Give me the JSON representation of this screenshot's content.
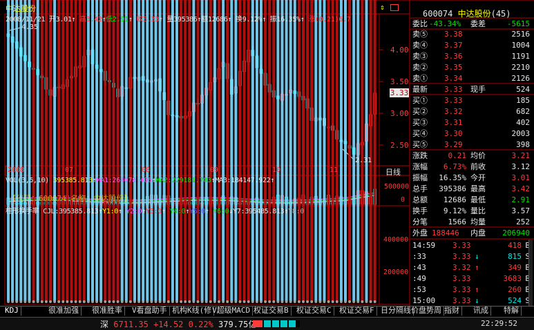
{
  "header": {
    "stock_name": "中达股份",
    "date": "2008/11/21",
    "open_label": "开",
    "open": "3.01",
    "high_label": "高",
    "high": "3.42",
    "low_label": "低",
    "low": "2.91",
    "close_label": "收",
    "close": "3.33",
    "volume_label": "量",
    "volume": "395386",
    "amount_label": "额",
    "amount": "12686",
    "turnover_label": "换",
    "turnover": "9.12%",
    "amplitude_label": "振",
    "amplitude": "16.35%",
    "change_label": "涨",
    "change": "(0.21)6.7"
  },
  "price_chart": {
    "y_ticks": [
      "4.00",
      "3.50",
      "3.00",
      "2.50"
    ],
    "high_marker": "4.35",
    "low_marker": "2.31",
    "current_price_tag": "3.33",
    "x_labels": [
      "2008",
      "07",
      "08",
      "09",
      "10",
      "11"
    ],
    "period_label": "日线"
  },
  "volume_panel": {
    "title": "VOL(3,5,10)",
    "vol": "395385.813",
    "ma1_label": "MA1:",
    "ma1": "264078.406",
    "ma2_label": "MA2:",
    "ma2": "229181.703",
    "ma3_label": "MA3:",
    "ma3": "184147.922",
    "code_text": "【代码：600074 名称：中达股份】",
    "y_ticks": [
      "500000",
      "0"
    ]
  },
  "indicator_panel": {
    "title": "柱形换手率",
    "cjl_label": "CJL:",
    "cjl": "395385.813",
    "y1": "Y1:0",
    "y2": "Y2:0",
    "y3": "Y3:0",
    "y4": "Y4:0",
    "y5": "Y5:0",
    "y6": "Y6:0",
    "y7_label": "Y7:",
    "y7": "395485.813",
    "y8": "Y8:0",
    "y_ticks": [
      "400000",
      "200000"
    ]
  },
  "tabs": [
    "KDJ",
    "很准加强",
    "很准胜率",
    "V看盘助手",
    "机构K线(修",
    "V超级MACD",
    "权证交易B",
    "权证交易C",
    "权证交易F",
    "日分隔线",
    "价盘势周",
    "指财",
    "讯成",
    "特解"
  ],
  "status_bar": {
    "index_name": "深",
    "index_value": "6711.35",
    "index_change": "+14.52",
    "index_pct": "0.22%",
    "index_amount": "379.75亿",
    "time": "22:29:52"
  },
  "quote": {
    "code": "600074",
    "name": "中达股份",
    "rank": "(45)",
    "weibi_label": "委比",
    "weibi": "-43.34%",
    "weicha_label": "委差",
    "weicha": "-5615",
    "asks": [
      {
        "label": "卖⑤",
        "price": "3.38",
        "vol": "2516"
      },
      {
        "label": "卖④",
        "price": "3.37",
        "vol": "1004"
      },
      {
        "label": "卖③",
        "price": "3.36",
        "vol": "1191"
      },
      {
        "label": "卖②",
        "price": "3.35",
        "vol": "2210"
      },
      {
        "label": "卖①",
        "price": "3.34",
        "vol": "2126"
      }
    ],
    "last_label": "最新",
    "last": "3.33",
    "cur_hand_label": "现手",
    "cur_hand": "524",
    "bids": [
      {
        "label": "买①",
        "price": "3.33",
        "vol": "185"
      },
      {
        "label": "买②",
        "price": "3.32",
        "vol": "682"
      },
      {
        "label": "买③",
        "price": "3.31",
        "vol": "402"
      },
      {
        "label": "买④",
        "price": "3.30",
        "vol": "2003"
      },
      {
        "label": "买⑤",
        "price": "3.29",
        "vol": "398"
      }
    ],
    "stats": [
      {
        "l1": "涨跌",
        "v1": "0.21",
        "l2": "均价",
        "v2": "3.21"
      },
      {
        "l1": "涨幅",
        "v1": "6.73%",
        "l2": "前收",
        "v2": "3.12"
      },
      {
        "l1": "振幅",
        "v1": "16.35%",
        "l2": "今开",
        "v2": "3.01"
      },
      {
        "l1": "总手",
        "v1": "395386",
        "l2": "最高",
        "v2": "3.42"
      },
      {
        "l1": "总额",
        "v1": "12686",
        "l2": "最低",
        "v2": "2.91"
      },
      {
        "l1": "换手",
        "v1": "9.12%",
        "l2": "量比",
        "v2": "3.57"
      },
      {
        "l1": "分笔",
        "v1": "1566",
        "l2": "均量",
        "v2": "252"
      }
    ],
    "outer_label": "外盘",
    "outer": "188446",
    "inner_label": "内盘",
    "inner": "206940",
    "ticks": [
      {
        "time": "14:59",
        "price": "3.33",
        "arrow": "",
        "vol": "418",
        "side": "B"
      },
      {
        "time": ":33",
        "price": "3.33",
        "arrow": "↓",
        "vol": "815",
        "side": "S"
      },
      {
        "time": ":43",
        "price": "3.32",
        "arrow": "↑",
        "vol": "349",
        "side": "B"
      },
      {
        "time": ":49",
        "price": "3.33",
        "arrow": "",
        "vol": "3683",
        "side": "B"
      },
      {
        "time": ":53",
        "price": "3.33",
        "arrow": "↑",
        "vol": "260",
        "side": "B"
      },
      {
        "time": "15:00",
        "price": "3.33",
        "arrow": "↓",
        "vol": "524",
        "side": "S"
      }
    ]
  }
}
